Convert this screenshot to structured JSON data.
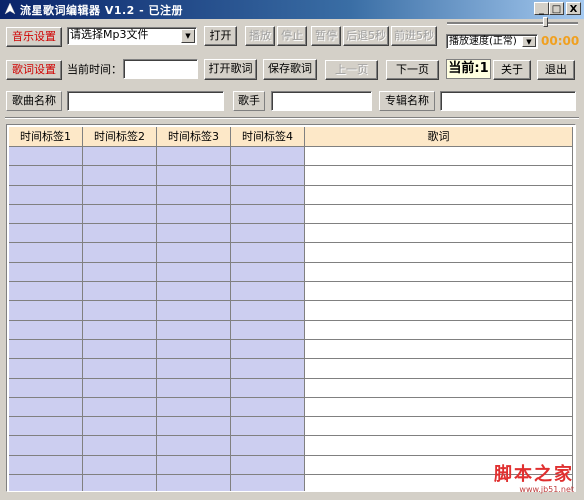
{
  "window": {
    "title": "流星歌词编辑器 V1.2 - 已注册",
    "minimize": "_",
    "maximize": "□",
    "close": "X"
  },
  "music_row": {
    "settings_button": "音乐设置",
    "file_select_value": "请选择Mp3文件",
    "open_button": "打开",
    "play_button": "播放",
    "stop_button": "停止",
    "pause_button": "暂停",
    "back5_button": "后退5秒",
    "forward5_button": "前进5秒",
    "speed_select_value": "播放速度(正常)",
    "time_display": "00:00"
  },
  "lyric_row": {
    "settings_button": "歌词设置",
    "current_time_label": "当前时间：",
    "current_time_value": "",
    "open_lyrics_button": "打开歌词",
    "save_lyrics_button": "保存歌词",
    "prev_page_button": "上一页",
    "next_page_button": "下一页",
    "current_indicator": "当前:1",
    "about_button": "关于",
    "exit_button": "退出"
  },
  "info_row": {
    "song_name_label": "歌曲名称",
    "song_name_value": "",
    "singer_label": "歌手",
    "singer_value": "",
    "album_label": "专辑名称",
    "album_value": ""
  },
  "table": {
    "headers": [
      "时间标签1",
      "时间标签2",
      "时间标签3",
      "时间标签4",
      "歌词"
    ],
    "row_count": 18
  },
  "watermark": {
    "text": "脚本之家",
    "url": "www.jb51.net"
  },
  "colors": {
    "accent_red": "#d00000",
    "header_bg": "#fde8c8",
    "tag_cell_bg": "#cccef0",
    "time_display": "#f0a020"
  }
}
